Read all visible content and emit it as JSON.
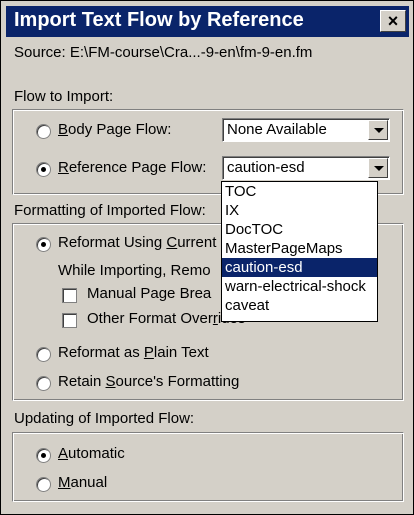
{
  "window": {
    "title": "Import Text Flow by Reference",
    "close_label": "×"
  },
  "source": {
    "label": "Source:",
    "path": "E:\\FM-course\\Cra...-9-en\\fm-9-en.fm"
  },
  "flow_section": {
    "heading": "Flow to Import:",
    "body_page": {
      "prefix": "",
      "ul": "B",
      "suffix": "ody Page Flow:",
      "selected": false,
      "value": "None Available"
    },
    "reference_page": {
      "prefix": "",
      "ul": "R",
      "suffix": "eference Page Flow:",
      "selected": true,
      "value": "caution-esd"
    },
    "options": [
      "TOC",
      "IX",
      "DocTOC",
      "MasterPageMaps",
      "caution-esd",
      "warn-electrical-shock",
      "caveat"
    ],
    "highlighted_index": 4
  },
  "formatting_section": {
    "heading": "Formatting of Imported Flow:",
    "reformat_current": {
      "prefix": "Reformat Using ",
      "ul": "C",
      "suffix": "urrent",
      "selected": true
    },
    "while_importing": "While Importing, Remo",
    "manual_page_breaks": {
      "prefix": "Manual Page Brea",
      "checked": false
    },
    "other_format": {
      "prefix": "Other Format Over",
      "ul": "r",
      "suffix": "ides",
      "checked": false
    },
    "plain_text": {
      "prefix": "Reformat as ",
      "ul": "P",
      "suffix": "lain Text",
      "selected": false
    },
    "retain_source": {
      "prefix": "Retain ",
      "ul": "S",
      "suffix": "ource's Formatting",
      "selected": false
    }
  },
  "updating_section": {
    "heading": "Updating of Imported Flow:",
    "automatic": {
      "prefix": "",
      "ul": "A",
      "suffix": "utomatic",
      "selected": true
    },
    "manual": {
      "prefix": "",
      "ul": "M",
      "suffix": "anual",
      "selected": false
    }
  }
}
